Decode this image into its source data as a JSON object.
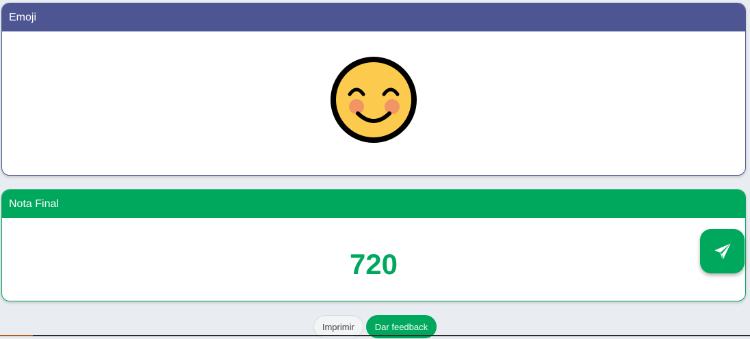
{
  "emoji_card": {
    "title": "Emoji",
    "emoji_icon": "smiling-face-with-smiling-eyes-icon"
  },
  "grade_card": {
    "title": "Nota Final",
    "value": "720"
  },
  "fab": {
    "icon": "paper-plane-icon"
  },
  "actions": {
    "print_label": "Imprimir",
    "feedback_label": "Dar feedback"
  },
  "colors": {
    "emoji_header": "#4d5593",
    "grade_header": "#00a85e",
    "grade_value": "#00a85e"
  }
}
